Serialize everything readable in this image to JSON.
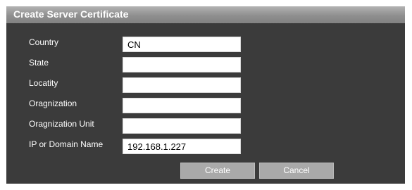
{
  "dialog": {
    "title": "Create Server Certificate"
  },
  "form": {
    "fields": [
      {
        "label": "Country",
        "value": "CN",
        "placeholder": ""
      },
      {
        "label": "State",
        "value": "",
        "placeholder": ""
      },
      {
        "label": "Locatity",
        "value": "",
        "placeholder": ""
      },
      {
        "label": "Oragnization",
        "value": "",
        "placeholder": ""
      },
      {
        "label": "Oragnization Unit",
        "value": "",
        "placeholder": ""
      },
      {
        "label": "IP or Domain Name",
        "value": "192.168.1.227",
        "placeholder": ""
      }
    ]
  },
  "buttons": {
    "create_label": "Create",
    "cancel_label": "Cancel"
  },
  "colors": {
    "panel_background": "#3b3b3b",
    "title_bar": "#959595",
    "button_background": "#a9a9a9",
    "text": "#ffffff"
  }
}
